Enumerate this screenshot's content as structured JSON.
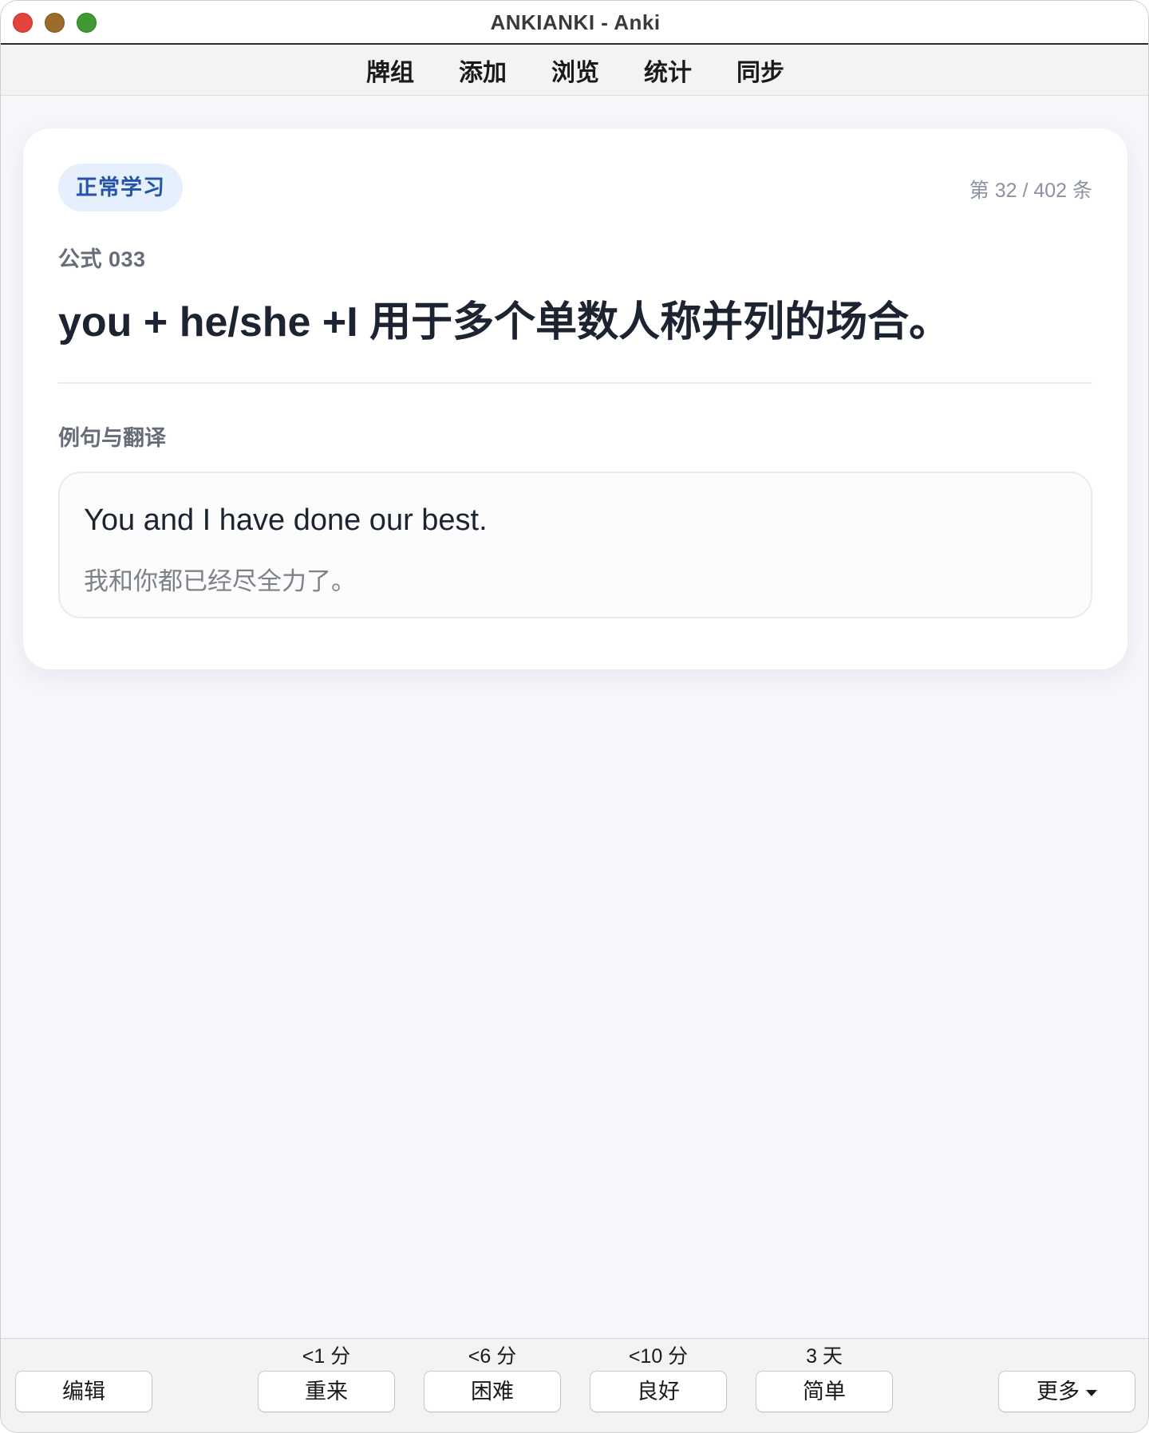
{
  "window": {
    "title": "ANKIANKI - Anki"
  },
  "toolbar": {
    "items": [
      {
        "label": "牌组"
      },
      {
        "label": "添加"
      },
      {
        "label": "浏览"
      },
      {
        "label": "统计"
      },
      {
        "label": "同步"
      }
    ]
  },
  "card": {
    "tag": "正常学习",
    "counter": "第 32 / 402 条",
    "formula_number": "公式 033",
    "formula_text": "you + he/she +I 用于多个单数人称并列的场合。",
    "section_label": "例句与翻译",
    "example": {
      "english": "You and I have done our best.",
      "chinese": "我和你都已经尽全力了。"
    }
  },
  "bottom": {
    "edit_label": "编辑",
    "more_label": "更多",
    "answers": [
      {
        "label": "重来",
        "interval": "<1 分"
      },
      {
        "label": "困难",
        "interval": "<6 分"
      },
      {
        "label": "良好",
        "interval": "<10 分"
      },
      {
        "label": "简单",
        "interval": "3 天"
      }
    ]
  },
  "icons": {
    "more_dropdown": "chevron-down-icon"
  },
  "colors": {
    "tag_bg": "#e6f0fd",
    "tag_text": "#2453a8",
    "close": "#e0443a",
    "minimize": "#9a6b2a",
    "zoom": "#3f9a32"
  }
}
